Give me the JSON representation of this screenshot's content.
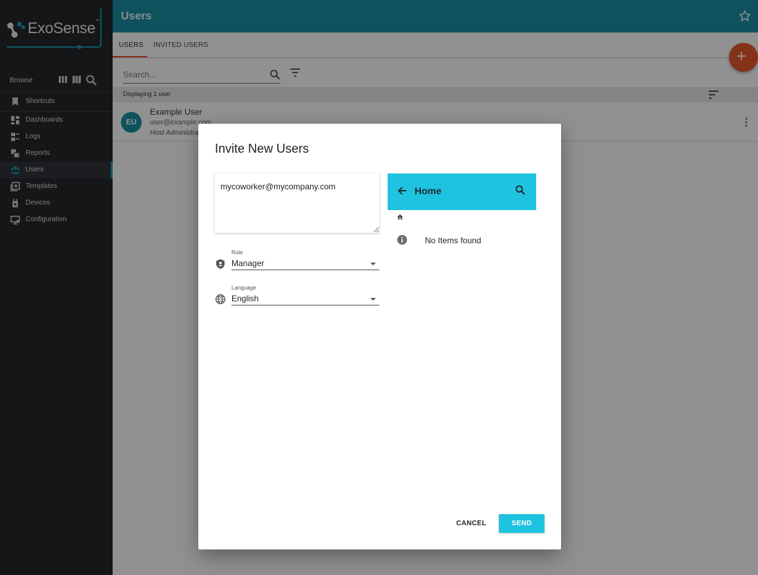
{
  "brand": {
    "logo_text": "ExoSense",
    "logo_mark": "™"
  },
  "sidebar": {
    "browse_label": "Browse",
    "browse_icons": [
      "columns-icon",
      "map-icon",
      "magnify-icon"
    ],
    "items": [
      {
        "label": "Shortcuts",
        "icon": "bookmark-icon"
      },
      {
        "label": "Dashboards",
        "icon": "dashboard-icon"
      },
      {
        "label": "Logs",
        "icon": "logs-icon"
      },
      {
        "label": "Reports",
        "icon": "reports-icon"
      },
      {
        "label": "Users",
        "icon": "users-icon",
        "active": true
      },
      {
        "label": "Templates",
        "icon": "templates-icon"
      },
      {
        "label": "Devices",
        "icon": "devices-icon"
      },
      {
        "label": "Configuration",
        "icon": "configuration-icon"
      }
    ]
  },
  "header": {
    "title": "Users"
  },
  "tabs": [
    {
      "label": "USERS",
      "active": true
    },
    {
      "label": "INVITED USERS",
      "active": false
    }
  ],
  "fab": {
    "label": "+"
  },
  "search": {
    "placeholder": "Search..."
  },
  "list": {
    "count_text": "Displaying 1 user",
    "users": [
      {
        "initials": "EU",
        "name": "Example User",
        "email": "user@example.com",
        "role": "Host Administrator"
      }
    ]
  },
  "dialog": {
    "title": "Invite New Users",
    "emails_value": "mycoworker@mycompany.com",
    "role": {
      "label": "Role",
      "value": "Manager"
    },
    "language": {
      "label": "Language",
      "value": "English"
    },
    "browser": {
      "title": "Home",
      "empty_text": "No Items found"
    },
    "cancel_label": "CANCEL",
    "send_label": "SEND"
  },
  "colors": {
    "accent": "#1a8ea0",
    "accent_light": "#1ec3e0",
    "fab": "#e4572e",
    "sidebar_bg": "#23262a"
  }
}
